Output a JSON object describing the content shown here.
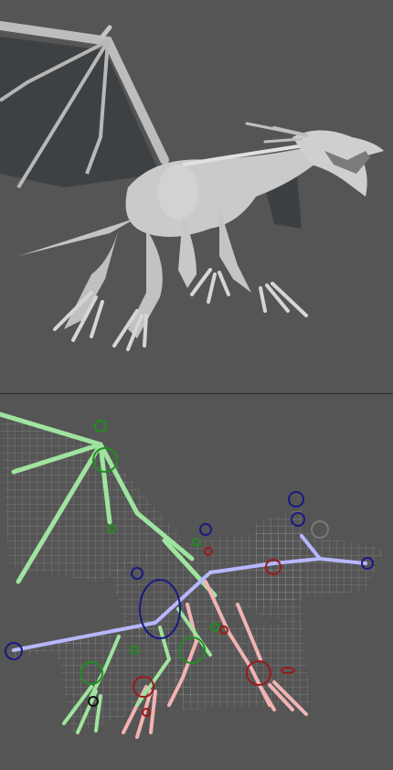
{
  "views": {
    "top": {
      "label": "",
      "shading": "smooth-shaded"
    },
    "bottom": {
      "label": "",
      "shading": "wireframe-with-rig"
    }
  },
  "colors": {
    "background": "#555555",
    "model": "#c9c9c9",
    "wing_membrane": "#3f4244",
    "wireframe": "#cfcfcf",
    "bone_green": "#9fe49f",
    "bone_pink": "#f2b3b3",
    "bone_blue": "#b7b7ff",
    "control_blue": "#1a1a80",
    "control_green": "#1f8f1f",
    "control_red": "#9a1a1a"
  },
  "icons": [
    "dragon-model",
    "dragon-rig"
  ]
}
